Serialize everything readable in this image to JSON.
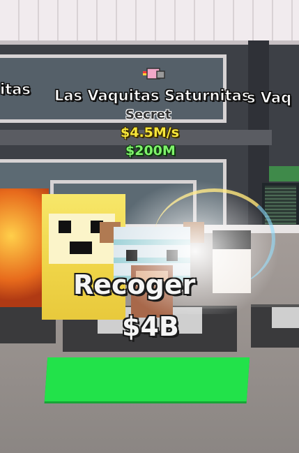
{
  "colors": {
    "rate": "#f6e53a",
    "price": "#7ff26b",
    "pad": "#22e24a",
    "roof": "#f1ebee"
  },
  "overhead": {
    "left_name_partial": "itas",
    "name": "Las Vaquitas Saturnitas",
    "right_name_partial": "s Vaq",
    "rarity": "Secret",
    "rate": "$4.5M/s",
    "price": "$200M",
    "icon": "nyan-cat-icon"
  },
  "prompt": {
    "action": "Recoger",
    "price": "$4B"
  }
}
